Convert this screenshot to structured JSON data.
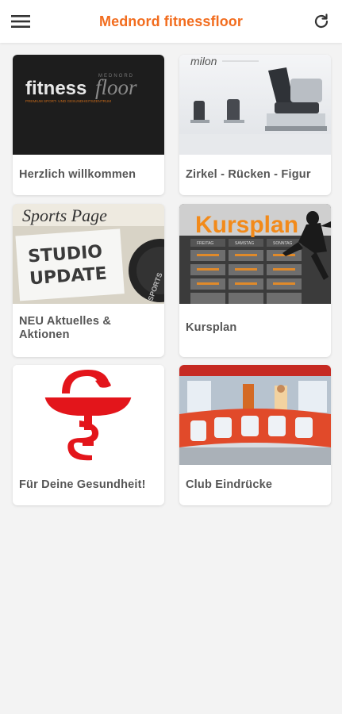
{
  "app": {
    "title": "Mednord fitnessfloor"
  },
  "colors": {
    "accent": "#f26d1f",
    "background": "#f3f3f3",
    "card": "#ffffff",
    "label": "#555555"
  },
  "icons": {
    "menu": "hamburger-menu-icon",
    "refresh": "refresh-icon"
  },
  "tiles": [
    {
      "label": "Herzlich willkommen",
      "image_text": {
        "brand_a": "fitness",
        "brand_b": "floor",
        "small_top": "MEDNORD",
        "tagline": "PREMIUM SPORT- UND GESUNDHEITSZENTRUM"
      }
    },
    {
      "label": "Zirkel - Rücken - Figur",
      "image_text": {
        "logo": "milon"
      }
    },
    {
      "label": "NEU Aktuelles & Aktionen",
      "image_text": {
        "masthead": "Sports Page",
        "headline_1": "STUDIO",
        "headline_2": "UPDATE",
        "plate": "SPORTS"
      }
    },
    {
      "label": "Kursplan",
      "image_text": {
        "title": "Kursplan",
        "cols": [
          "FREITAG",
          "SAMSTAG",
          "SONNTAG"
        ]
      }
    },
    {
      "label": "Für Deine Gesundheit!",
      "image_text": {}
    },
    {
      "label": "Club Eindrücke",
      "image_text": {}
    }
  ]
}
